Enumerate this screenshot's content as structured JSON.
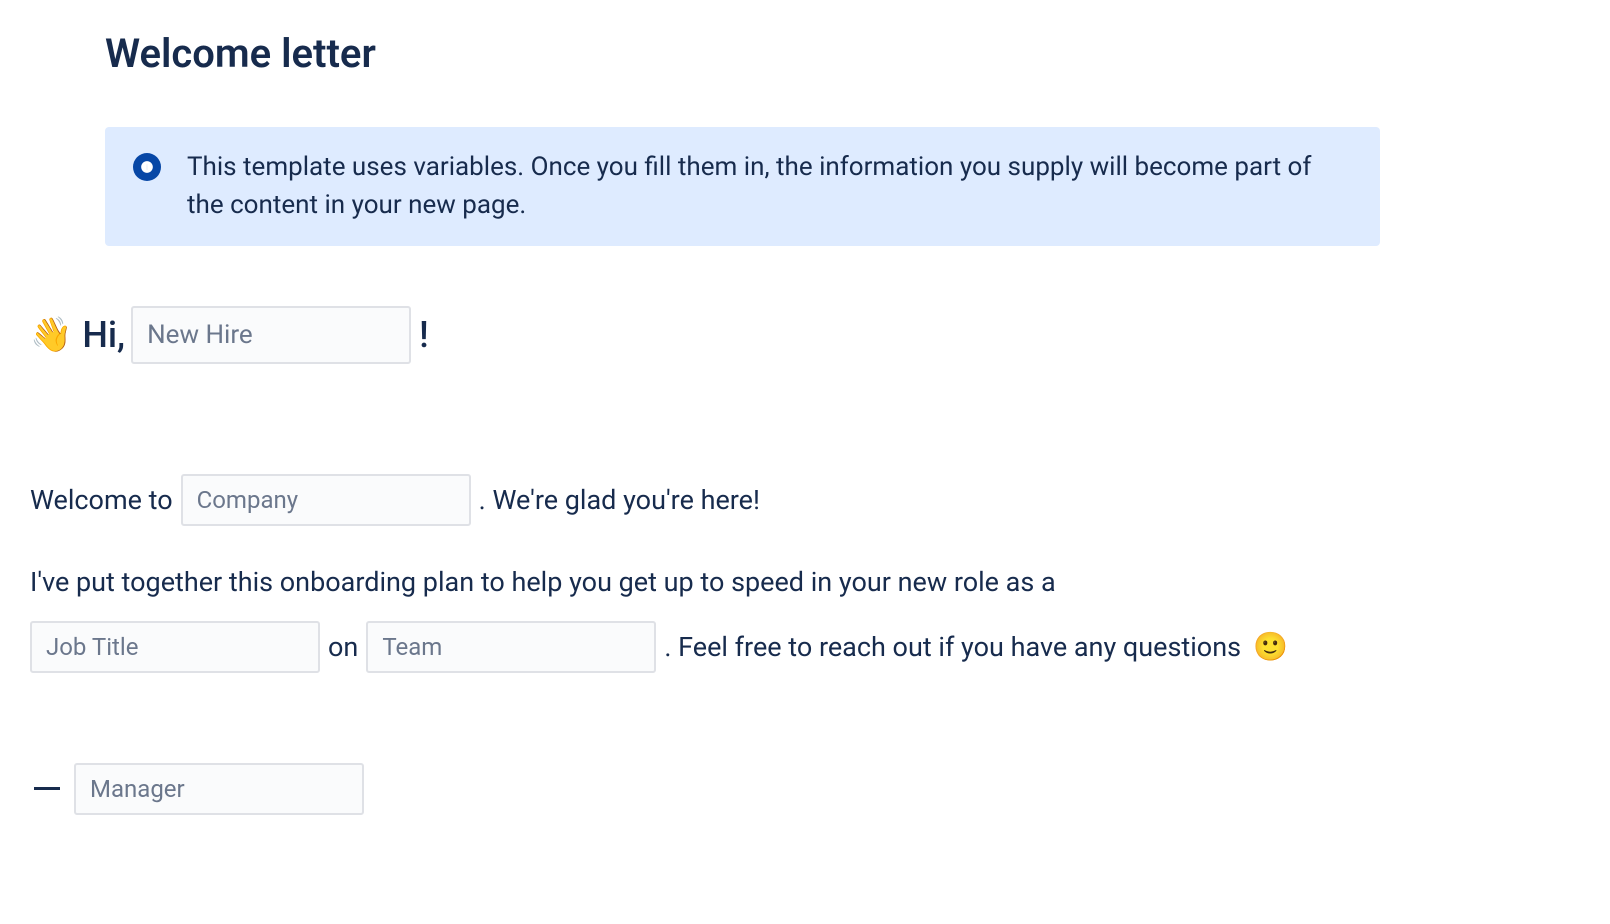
{
  "title": "Welcome letter",
  "info": {
    "text": "This template uses variables. Once you fill them in, the information you supply will become part of the content in your new page."
  },
  "greeting": {
    "wave_emoji": "👋",
    "hi": "Hi,",
    "new_hire_placeholder": "New Hire",
    "exclaim": "!"
  },
  "body": {
    "welcome_to": "Welcome to",
    "company_placeholder": "Company",
    "glad_here": ". We're glad you're here!",
    "onboarding_intro": "I've put together this onboarding plan to help you get up to speed in your new role as a",
    "job_title_placeholder": "Job Title",
    "on_word": "on",
    "team_placeholder": "Team",
    "reach_out": ". Feel free to reach out if you have any questions",
    "smile_emoji": "🙂"
  },
  "signature": {
    "manager_placeholder": "Manager"
  }
}
